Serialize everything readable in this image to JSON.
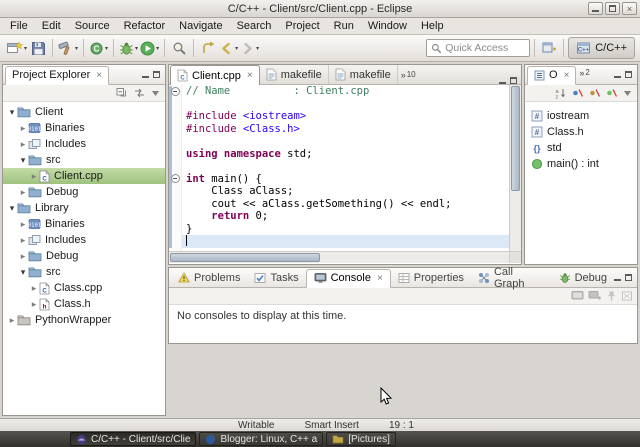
{
  "window": {
    "title": "C/C++ - Client/src/Client.cpp - Eclipse"
  },
  "menu_bar": {
    "items": [
      "File",
      "Edit",
      "Source",
      "Refactor",
      "Navigate",
      "Search",
      "Project",
      "Run",
      "Window",
      "Help"
    ]
  },
  "toolbar": {
    "quick_access": "Quick Access",
    "perspective": "C/C++",
    "buttons": [
      {
        "name": "new-wizard",
        "icon": "new",
        "dropdown": true
      },
      {
        "name": "save",
        "icon": "save"
      },
      {
        "type": "sep"
      },
      {
        "name": "build",
        "icon": "hammer",
        "dropdown": true
      },
      {
        "type": "sep"
      },
      {
        "name": "new-cpp-class",
        "icon": "class",
        "dropdown": true
      },
      {
        "type": "sep"
      },
      {
        "name": "debug",
        "icon": "bug",
        "dropdown": true
      },
      {
        "name": "run",
        "icon": "run",
        "dropdown": true
      },
      {
        "type": "sep"
      },
      {
        "name": "search",
        "icon": "search"
      },
      {
        "type": "sep"
      },
      {
        "name": "last-edit-location",
        "icon": "last-edit"
      },
      {
        "name": "back",
        "icon": "back",
        "dropdown": true
      },
      {
        "name": "forward",
        "icon": "forward",
        "dropdown": true
      }
    ]
  },
  "project_explorer": {
    "title": "Project Explorer",
    "toolbar_icons": [
      "collapse-all",
      "link-with-editor",
      "view-menu"
    ],
    "tree": [
      {
        "label": "Client",
        "level": 0,
        "arrow": "expanded",
        "icon": "folder"
      },
      {
        "label": "Binaries",
        "level": 1,
        "arrow": "collapsed",
        "icon": "binaries"
      },
      {
        "label": "Includes",
        "level": 1,
        "arrow": "collapsed",
        "icon": "includes"
      },
      {
        "label": "src",
        "level": 1,
        "arrow": "expanded",
        "icon": "folder"
      },
      {
        "label": "Client.cpp",
        "level": 2,
        "arrow": "collapsed",
        "icon": "cpp-file",
        "selected": true
      },
      {
        "label": "Debug",
        "level": 1,
        "arrow": "collapsed",
        "icon": "folder"
      },
      {
        "label": "Library",
        "level": 0,
        "arrow": "expanded",
        "icon": "folder"
      },
      {
        "label": "Binaries",
        "level": 1,
        "arrow": "collapsed",
        "icon": "binaries"
      },
      {
        "label": "Includes",
        "level": 1,
        "arrow": "collapsed",
        "icon": "includes"
      },
      {
        "label": "Debug",
        "level": 1,
        "arrow": "collapsed",
        "icon": "folder"
      },
      {
        "label": "src",
        "level": 1,
        "arrow": "expanded",
        "icon": "folder"
      },
      {
        "label": "Class.cpp",
        "level": 2,
        "arrow": "collapsed",
        "icon": "cpp-file"
      },
      {
        "label": "Class.h",
        "level": 2,
        "arrow": "collapsed",
        "icon": "h-file"
      },
      {
        "label": "PythonWrapper",
        "level": 0,
        "arrow": "collapsed",
        "icon": "folder-gray"
      }
    ]
  },
  "editor": {
    "tabs": [
      {
        "label": "Client.cpp",
        "icon": "cpp-file",
        "active": true
      },
      {
        "label": "makefile",
        "icon": "makefile",
        "active": false
      },
      {
        "label": "makefile",
        "icon": "makefile",
        "active": false
      }
    ],
    "tab_overflow_count": "10",
    "code": [
      {
        "fold": true,
        "tokens": [
          {
            "t": "// Name          : Client.cpp",
            "c": "comment"
          }
        ]
      },
      {
        "tokens": []
      },
      {
        "tokens": [
          {
            "t": "#include ",
            "c": "directive"
          },
          {
            "t": "<iostream>",
            "c": "header"
          }
        ]
      },
      {
        "tokens": [
          {
            "t": "#include ",
            "c": "directive"
          },
          {
            "t": "<Class.h>",
            "c": "header"
          }
        ]
      },
      {
        "tokens": []
      },
      {
        "tokens": [
          {
            "t": "using namespace",
            "c": "keyword"
          },
          {
            "t": " std;",
            "c": "plain"
          }
        ]
      },
      {
        "tokens": []
      },
      {
        "fold": true,
        "tokens": [
          {
            "t": "int",
            "c": "keyword"
          },
          {
            "t": " main() {",
            "c": "plain"
          }
        ]
      },
      {
        "tokens": [
          {
            "t": "    Class aClass;",
            "c": "plain"
          }
        ]
      },
      {
        "tokens": [
          {
            "t": "    cout << aClass.getSomething() << endl;",
            "c": "plain"
          }
        ]
      },
      {
        "tokens": [
          {
            "t": "    ",
            "c": "plain"
          },
          {
            "t": "return",
            "c": "keyword"
          },
          {
            "t": " 0;",
            "c": "plain"
          }
        ]
      },
      {
        "tokens": [
          {
            "t": "}",
            "c": "plain"
          }
        ]
      },
      {
        "current": true,
        "tokens": []
      }
    ]
  },
  "outline": {
    "tab": "O",
    "overflow_count": "2",
    "toolbar_icons": [
      "sort",
      "hide-fields",
      "hide-static",
      "hide-non-public",
      "view-menu"
    ],
    "items": [
      {
        "label": "iostream",
        "icon": "include"
      },
      {
        "label": "Class.h",
        "icon": "include"
      },
      {
        "label": "std",
        "icon": "namespace"
      },
      {
        "label": "main() : int",
        "icon": "method"
      }
    ]
  },
  "console_panel": {
    "tabs": [
      {
        "label": "Problems",
        "icon": "problems"
      },
      {
        "label": "Tasks",
        "icon": "tasks"
      },
      {
        "label": "Console",
        "icon": "console-i",
        "active": true
      },
      {
        "label": "Properties",
        "icon": "properties"
      },
      {
        "label": "Call Graph",
        "icon": "callgraph"
      },
      {
        "label": "Debug",
        "icon": "debug-bug"
      }
    ],
    "toolbar_icons": [
      "display-selected-console",
      "open-console",
      "pin-console",
      "clear-console"
    ],
    "message": "No consoles to display at this time."
  },
  "status_bar": {
    "items": [
      "Writable",
      "Smart Insert",
      "19 : 1"
    ]
  },
  "taskbar": {
    "items": [
      {
        "label": "C/C++ - Client/src/Clie",
        "icon": "eclipse",
        "active": true
      },
      {
        "label": "Blogger: Linux, C++ a",
        "icon": "firefox",
        "active": false
      },
      {
        "label": "[Pictures]",
        "icon": "pictures",
        "active": false
      }
    ]
  },
  "colors": {
    "selection_green": "#9fc37f",
    "comment": "#3f7f5f",
    "keyword": "#7f0055",
    "header_include": "#2a00ff",
    "current_line": "#dce8f5"
  }
}
